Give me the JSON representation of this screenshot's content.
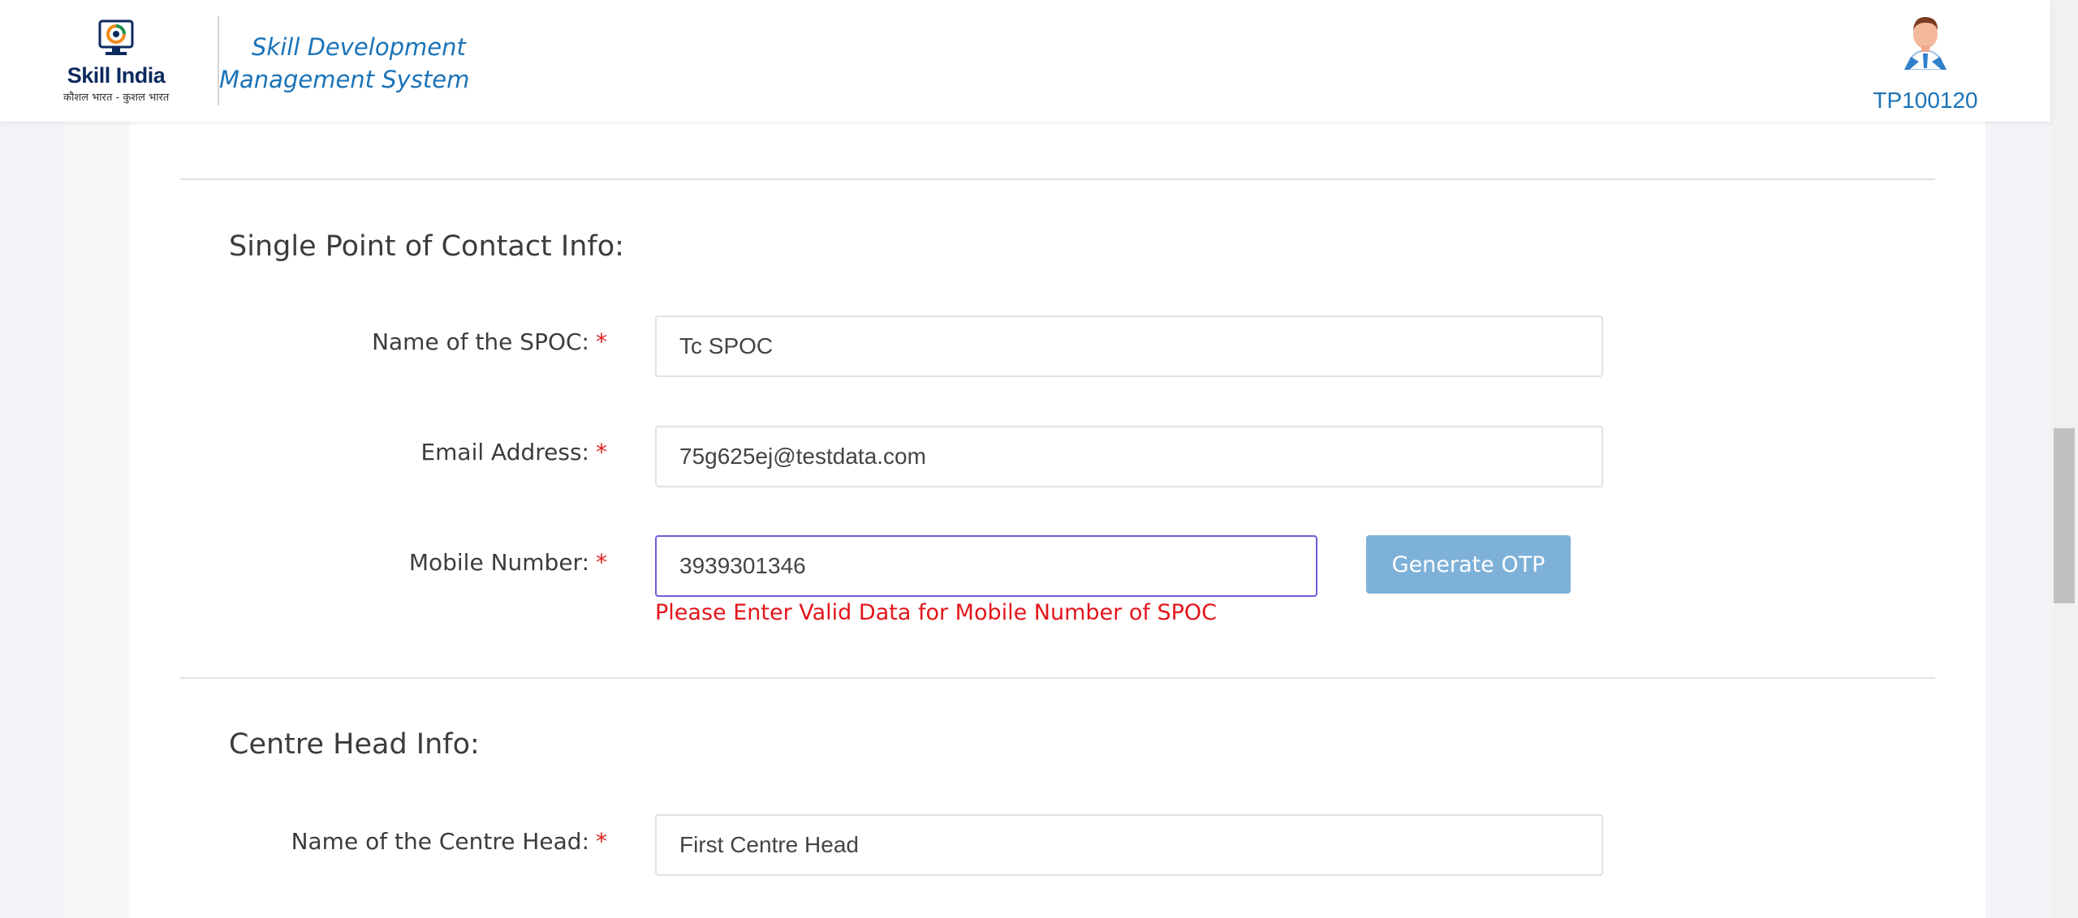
{
  "header": {
    "logo_text": "Skill India",
    "logo_tagline": "कौशल भारत - कुशल भारत",
    "app_title": "Skill Development Management System",
    "user_id": "TP100120"
  },
  "spoc": {
    "section_title": "Single Point of Contact Info:",
    "name_label": "Name of the SPOC:",
    "name_value": "Tc SPOC",
    "email_label": "Email Address:",
    "email_value": "75g625ej@testdata.com",
    "mobile_label": "Mobile Number:",
    "mobile_value": "3939301346",
    "generate_otp_label": "Generate OTP",
    "mobile_error": "Please Enter Valid Data for Mobile Number of SPOC",
    "required_marker": "*"
  },
  "centre_head": {
    "section_title": "Centre Head Info:",
    "name_label": "Name of the Centre Head:",
    "name_value": "First Centre Head",
    "required_marker": "*"
  },
  "colors": {
    "accent": "#1a73b8",
    "button": "#7eb1d8",
    "error": "#e3151a",
    "focus_border": "#6c5ed8"
  }
}
